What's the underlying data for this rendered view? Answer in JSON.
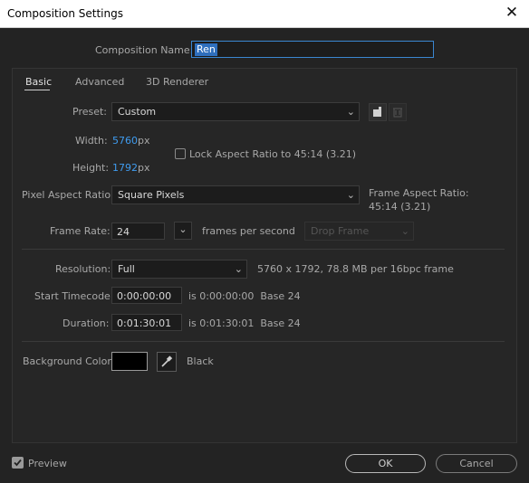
{
  "window": {
    "title": "Composition Settings"
  },
  "comp_name": {
    "label": "Composition Name:",
    "value": "Ren"
  },
  "tabs": [
    "Basic",
    "Advanced",
    "3D Renderer"
  ],
  "preset": {
    "label": "Preset:",
    "value": "Custom"
  },
  "width": {
    "label": "Width:",
    "value": "5760",
    "unit": "px"
  },
  "height": {
    "label": "Height:",
    "value": "1792",
    "unit": "px"
  },
  "lock_aspect": {
    "label": "Lock Aspect Ratio to 45:14 (3.21)",
    "checked": false
  },
  "pixel_aspect": {
    "label": "Pixel Aspect Ratio:",
    "value": "Square Pixels"
  },
  "frame_aspect": {
    "label": "Frame Aspect Ratio:",
    "value": "45:14 (3.21)"
  },
  "frame_rate": {
    "label": "Frame Rate:",
    "value": "24",
    "unit": "frames per second",
    "drop_frame": "Drop Frame"
  },
  "resolution": {
    "label": "Resolution:",
    "value": "Full",
    "info": "5760 x 1792, 78.8 MB per 16bpc frame"
  },
  "start_timecode": {
    "label": "Start Timecode:",
    "value": "0:00:00:00",
    "info": "is 0:00:00:00  Base 24"
  },
  "duration": {
    "label": "Duration:",
    "value": "0:01:30:01",
    "info": "is 0:01:30:01  Base 24"
  },
  "background": {
    "label": "Background Color:",
    "color": "#000000",
    "name": "Black"
  },
  "preview": {
    "label": "Preview",
    "checked": true
  },
  "buttons": {
    "ok": "OK",
    "cancel": "Cancel"
  }
}
